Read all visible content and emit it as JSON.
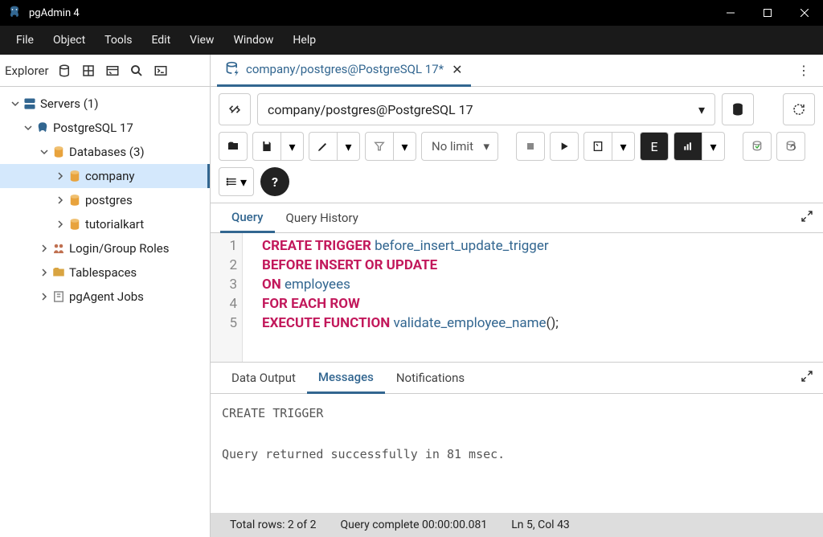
{
  "titlebar": {
    "title": "pgAdmin 4"
  },
  "menubar": [
    "File",
    "Object",
    "Tools",
    "Edit",
    "View",
    "Window",
    "Help"
  ],
  "sidebar_title": "Explorer",
  "tree": {
    "servers": "Servers (1)",
    "pg": "PostgreSQL 17",
    "databases": "Databases (3)",
    "db_company": "company",
    "db_postgres": "postgres",
    "db_tutorialkart": "tutorialkart",
    "login_roles": "Login/Group Roles",
    "tablespaces": "Tablespaces",
    "pgagent": "pgAgent Jobs"
  },
  "tab": {
    "label": "company/postgres@PostgreSQL 17*"
  },
  "conn_select": "company/postgres@PostgreSQL 17",
  "toolbar": {
    "limit_label": "No limit"
  },
  "inner_tabs": {
    "query": "Query",
    "history": "Query History"
  },
  "editor": {
    "lines": [
      "1",
      "2",
      "3",
      "4",
      "5"
    ],
    "l1_kw": "CREATE TRIGGER ",
    "l1_id": "before_insert_update_trigger",
    "l2": "BEFORE INSERT OR UPDATE",
    "l3_kw": "ON ",
    "l3_id": "employees",
    "l4": "FOR EACH ROW",
    "l5_kw": "EXECUTE FUNCTION ",
    "l5_id": "validate_employee_name",
    "l5_p": "();"
  },
  "out_tabs": {
    "data": "Data Output",
    "messages": "Messages",
    "notifications": "Notifications"
  },
  "output_text": "CREATE TRIGGER\n\nQuery returned successfully in 81 msec.",
  "statusbar": {
    "rows": "Total rows: 2 of 2",
    "complete": "Query complete 00:00:00.081",
    "pos": "Ln 5, Col 43"
  }
}
